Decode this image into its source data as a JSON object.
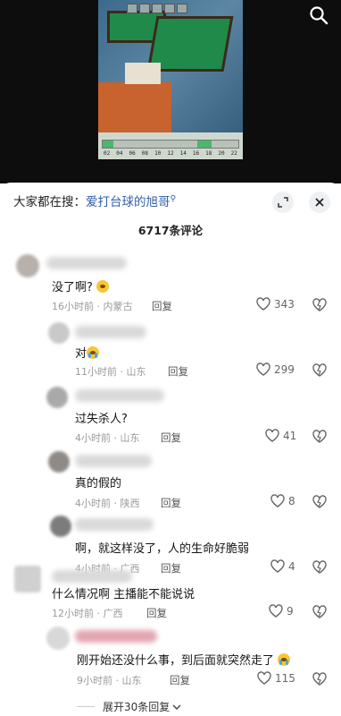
{
  "topbar": {
    "prefix": "大家都在搜：",
    "keyword": "爱打台球的旭哥"
  },
  "comments_count": "6717条评论",
  "comments": [
    {
      "text": "没了啊? ",
      "emoji": "shush",
      "time": "16小时前",
      "location": "内蒙古",
      "reply": "回复",
      "likes": "343"
    },
    {
      "text": "对",
      "emoji": "cry",
      "time": "11小时前",
      "location": "山东",
      "reply": "回复",
      "likes": "299"
    },
    {
      "text": "过失杀人?",
      "emoji": "",
      "time": "4小时前",
      "location": "山东",
      "reply": "回复",
      "likes": "41"
    },
    {
      "text": "真的假的",
      "emoji": "",
      "time": "4小时前",
      "location": "陕西",
      "reply": "回复",
      "likes": "8"
    },
    {
      "text": "啊，就这样没了，人的生命好脆弱",
      "emoji": "",
      "time": "4小时前",
      "location": "广西",
      "reply": "回复",
      "likes": "4"
    },
    {
      "text": "什么情况啊 主播能不能说说",
      "emoji": "",
      "time": "12小时前",
      "location": "广西",
      "reply": "回复",
      "likes": "9"
    },
    {
      "text": "刚开始还没什么事，到后面就突然走了",
      "emoji": "cry",
      "time": "9小时前",
      "location": "山东",
      "reply": "回复",
      "likes": "115"
    }
  ],
  "expand_label": "展开30条回复",
  "video": {
    "timeline_ticks": [
      "02",
      "04",
      "06",
      "08",
      "10",
      "12",
      "14",
      "16",
      "18",
      "20",
      "22"
    ]
  },
  "icons": {
    "search": "search-icon",
    "collapse": "collapse-icon",
    "close": "close-icon",
    "like": "heart-icon",
    "dislike": "broken-heart-icon"
  }
}
